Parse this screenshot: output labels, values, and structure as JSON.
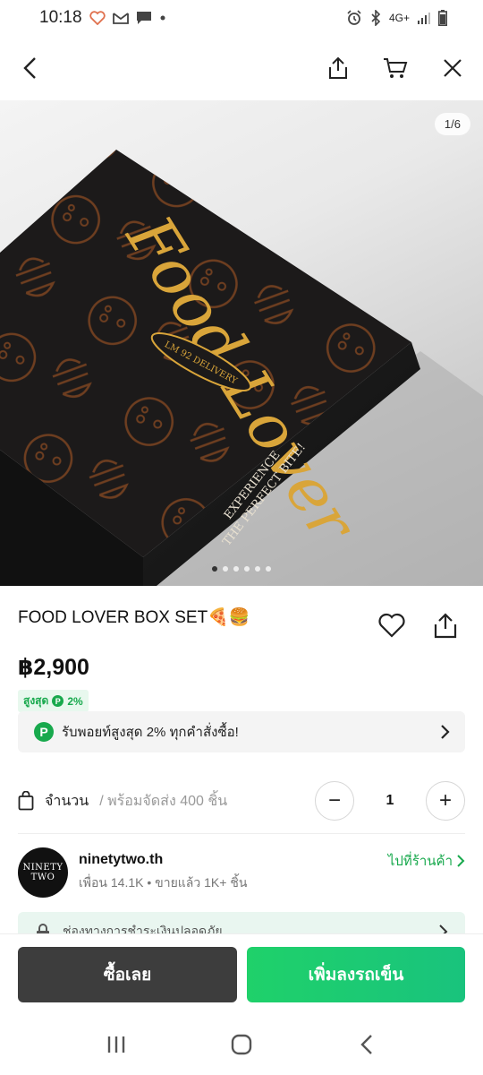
{
  "status": {
    "time": "10:18",
    "network": "4G+"
  },
  "hero": {
    "counter": "1/6",
    "dot_count": 6,
    "active_dot": 0,
    "box_script": "Food Lover",
    "box_badge": "LM 92 DELIVERY",
    "box_side_line1": "EXPERIENCE",
    "box_side_line2": "THE PERFECT BITE!"
  },
  "product": {
    "title": "FOOD LOVER BOX SET🍕🍔",
    "price": "฿2,900",
    "points_prefix": "สูงสุด",
    "points_icon": "P",
    "points_value": "2%"
  },
  "points_banner": {
    "icon": "P",
    "text": "รับพอยท์สูงสุด 2% ทุกคำสั่งซื้อ!"
  },
  "quantity": {
    "label": "จำนวน",
    "stock": "/ พร้อมจัดส่ง 400 ชิ้น",
    "value": "1",
    "minus": "−",
    "plus": "+"
  },
  "shop": {
    "avatar_line1": "NINETY",
    "avatar_line2": "TWO",
    "name": "ninetytwo.th",
    "meta": "เพื่อน 14.1K • ขายแล้ว 1K+ ชิ้น",
    "goto_label": "ไปที่ร้านค้า"
  },
  "secure": {
    "text": "ช่องทางการชำระเงินปลอดภัย"
  },
  "actions": {
    "buy_now": "ซื้อเลย",
    "add_to_cart": "เพิ่มลงรถเข็น"
  },
  "colors": {
    "accent_green": "#18a94d",
    "dark_button": "#3d3d3d",
    "box_black": "#1c1a1a",
    "gold": "#d9a53a"
  }
}
